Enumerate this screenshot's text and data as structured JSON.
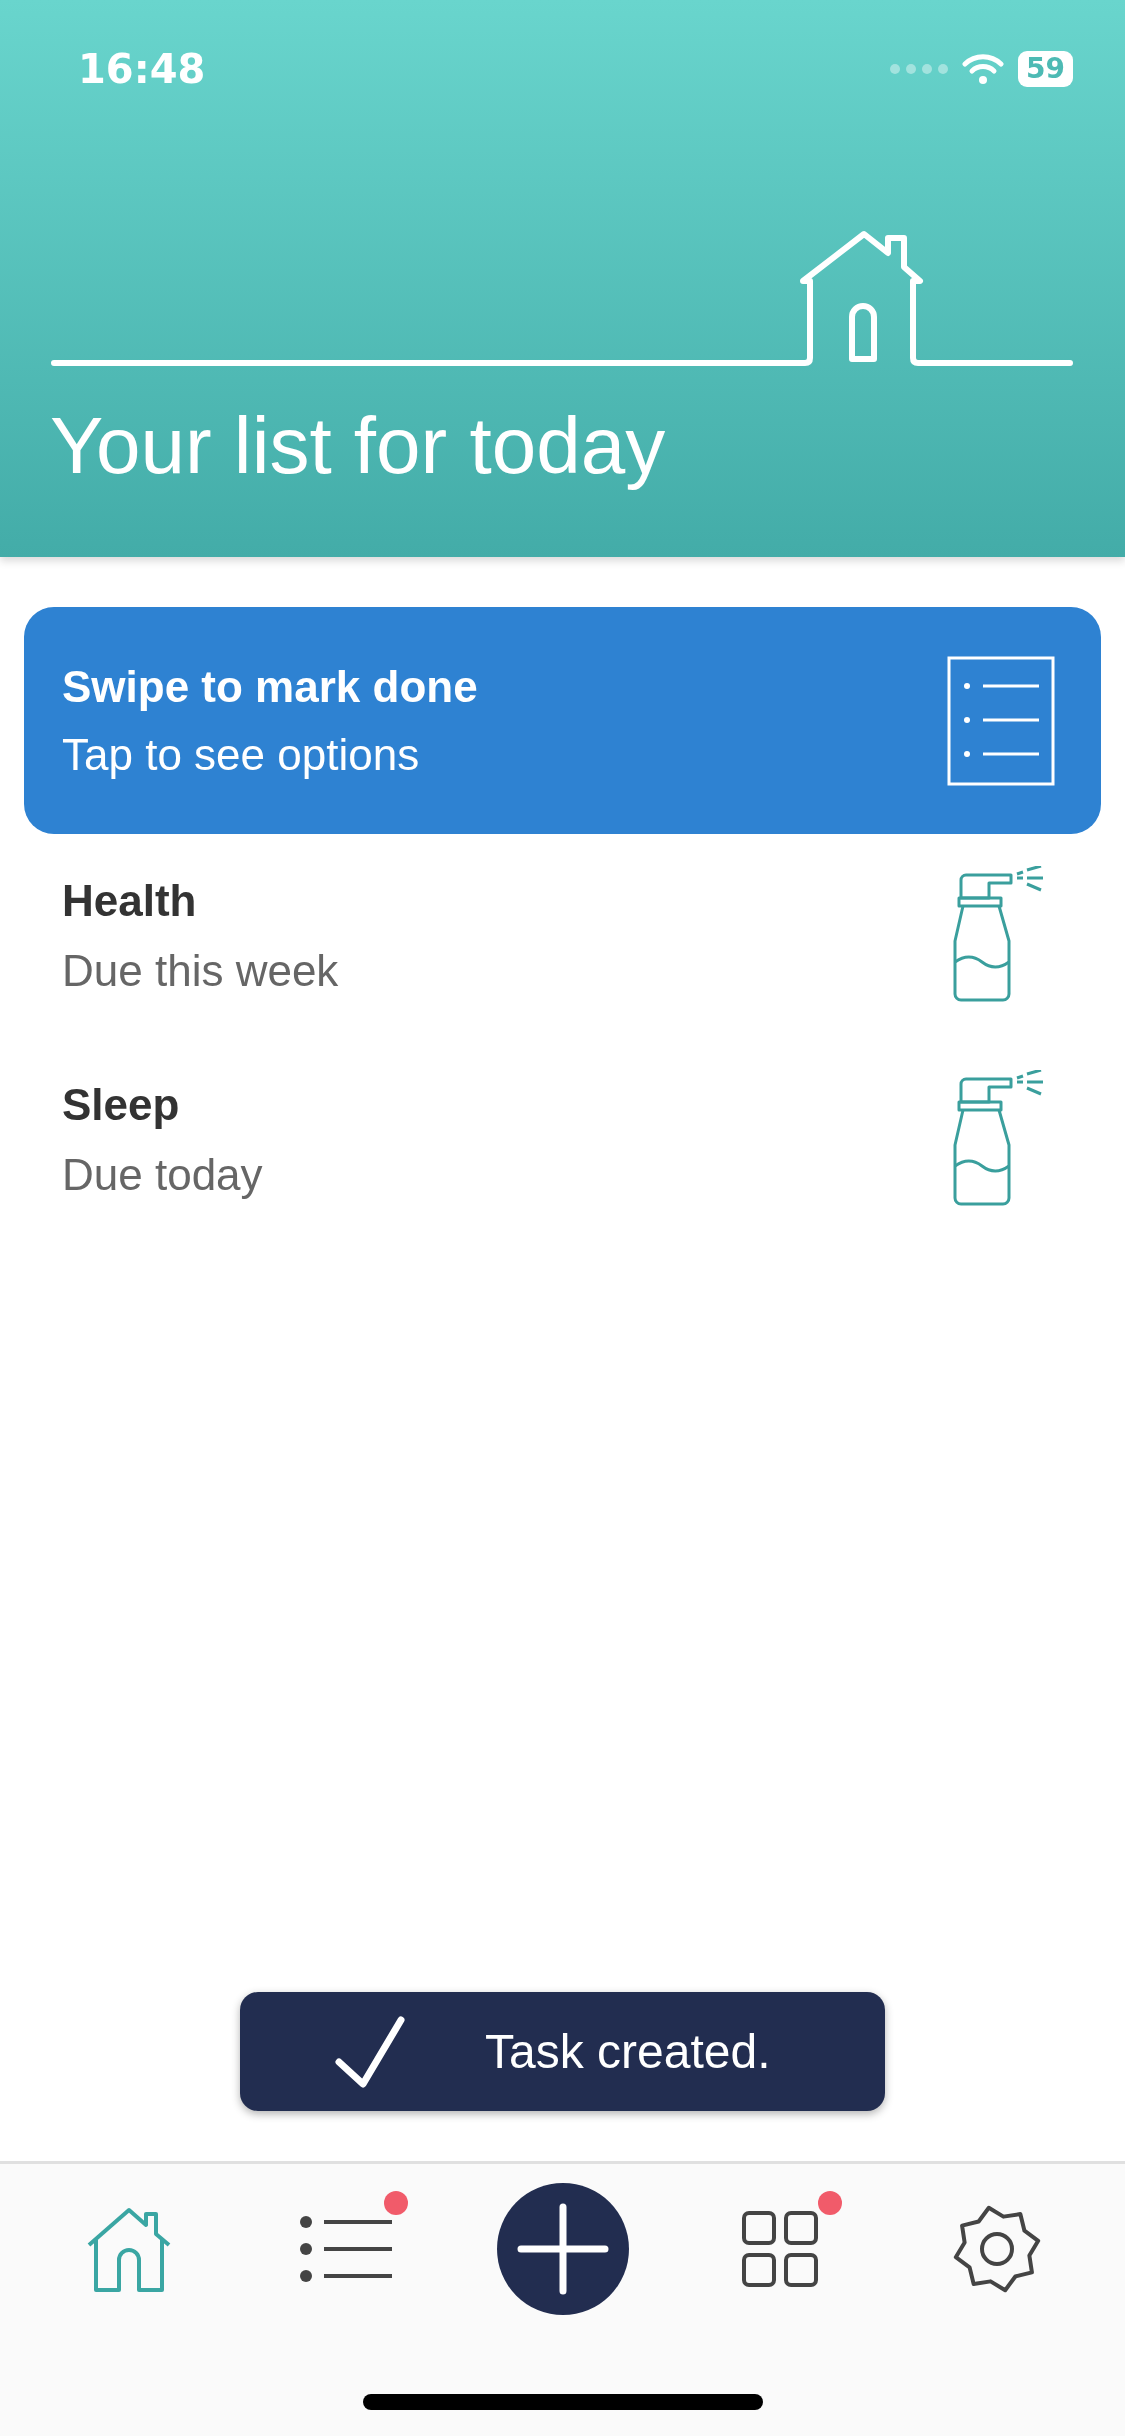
{
  "status_bar": {
    "time": "16:48",
    "battery": "59"
  },
  "header": {
    "title": "Your list for today"
  },
  "hint_card": {
    "title": "Swipe to mark done",
    "subtitle": "Tap to see options"
  },
  "tasks": [
    {
      "name": "Health",
      "due": "Due this week"
    },
    {
      "name": "Sleep",
      "due": "Due today"
    }
  ],
  "toast": {
    "message": "Task created."
  },
  "tab_bar": [
    {
      "kind": "home",
      "selected": true,
      "badge": false
    },
    {
      "kind": "list",
      "selected": false,
      "badge": true
    },
    {
      "kind": "add",
      "selected": false,
      "badge": false
    },
    {
      "kind": "grid",
      "selected": false,
      "badge": true
    },
    {
      "kind": "settings",
      "selected": false,
      "badge": false
    }
  ]
}
